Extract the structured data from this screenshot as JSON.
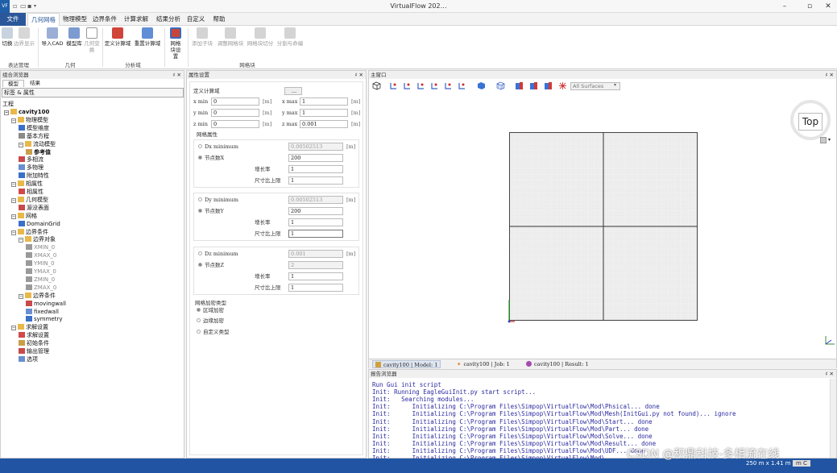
{
  "app": {
    "logo": "VF",
    "title": "VirtualFlow 202…",
    "window_controls": [
      "–",
      "▫",
      "✕"
    ]
  },
  "menu": {
    "tabs": [
      "文件",
      "几何网格",
      "物理模型",
      "边界条件",
      "计算求解",
      "结果分析",
      "自定义",
      "帮助"
    ]
  },
  "ribbon": {
    "groups": [
      {
        "label": "表达管理",
        "buttons": [
          "切换",
          "边界显示"
        ]
      },
      {
        "label": "几何",
        "buttons": [
          "导入CAD",
          "模型库",
          "几何变换"
        ]
      },
      {
        "label": "分析域",
        "buttons": [
          "定义计算域",
          "重置计算域"
        ]
      },
      {
        "label": "",
        "buttons": [
          "网格块设置"
        ]
      },
      {
        "label": "网格块",
        "buttons": [
          "添加子块",
          "调整网格块",
          "网格块切分",
          "分割与命编"
        ]
      }
    ]
  },
  "left_panel": {
    "title": "组合浏览器",
    "tabs": [
      "模型",
      "结果"
    ],
    "tag_header": "标签 & 属性",
    "tree_root": "工程",
    "tree": [
      {
        "label": "cavity100",
        "level": 0,
        "bold": true
      },
      {
        "label": "物理模型",
        "level": 1
      },
      {
        "label": "模型维度",
        "level": 2
      },
      {
        "label": "基本方程",
        "level": 2
      },
      {
        "label": "流动模型",
        "level": 2
      },
      {
        "label": "参考值",
        "level": 3,
        "bold": true
      },
      {
        "label": "多相流",
        "level": 2
      },
      {
        "label": "多物理",
        "level": 2
      },
      {
        "label": "附加特性",
        "level": 2
      },
      {
        "label": "相属性",
        "level": 1
      },
      {
        "label": "相属性",
        "level": 2
      },
      {
        "label": "几何模型",
        "level": 1
      },
      {
        "label": "源没表面",
        "level": 2
      },
      {
        "label": "网格",
        "level": 1
      },
      {
        "label": "DomainGrid",
        "level": 2
      },
      {
        "label": "边界条件",
        "level": 1
      },
      {
        "label": "边界对象",
        "level": 2
      },
      {
        "label": "XMIN_0",
        "level": 3,
        "gray": true
      },
      {
        "label": "XMAX_0",
        "level": 3,
        "gray": true
      },
      {
        "label": "YMIN_0",
        "level": 3,
        "gray": true
      },
      {
        "label": "YMAX_0",
        "level": 3,
        "gray": true
      },
      {
        "label": "ZMIN_0",
        "level": 3,
        "gray": true
      },
      {
        "label": "ZMAX_0",
        "level": 3,
        "gray": true
      },
      {
        "label": "边界条件",
        "level": 2
      },
      {
        "label": "movingwall",
        "level": 3
      },
      {
        "label": "fixedwall",
        "level": 3
      },
      {
        "label": "symmetry",
        "level": 3
      },
      {
        "label": "求解设置",
        "level": 1
      },
      {
        "label": "求解设置",
        "level": 2
      },
      {
        "label": "初始条件",
        "level": 2
      },
      {
        "label": "输出管理",
        "level": 2
      },
      {
        "label": "选项",
        "level": 2
      }
    ]
  },
  "props": {
    "title": "属性设置",
    "domain_label": "定义计算域",
    "dots_button": "...",
    "xmin_label": "x min",
    "xmin": "0",
    "xmax_label": "x max",
    "xmax": "1",
    "ymin_label": "y min",
    "ymin": "0",
    "ymax_label": "y max",
    "ymax": "1",
    "zmin_label": "z min",
    "zmin": "0",
    "zmax_label": "z max",
    "zmax": "0.001",
    "unit": "[m]",
    "mesh_props_label": "网格属性",
    "x": {
      "min_label": "Dx minimum",
      "min": "0.00502513",
      "count_label": "节点数X",
      "count": "200",
      "growth_label": "增长率",
      "growth": "1",
      "ratio_label": "尺寸比上限",
      "ratio": "1"
    },
    "y": {
      "min_label": "Dy minimum",
      "min": "0.00502513",
      "count_label": "节点数Y",
      "count": "200",
      "growth_label": "增长率",
      "growth": "1",
      "ratio_label": "尺寸比上限",
      "ratio": "1"
    },
    "z": {
      "min_label": "Dz minimum",
      "min": "0.001",
      "count_label": "节点数Z",
      "count": "2",
      "growth_label": "增长率",
      "growth": "1",
      "ratio_label": "尺寸比上限",
      "ratio": "1"
    },
    "refine_label": "网格加密类型",
    "refine_options": [
      "区域加密",
      "边缘加密",
      "自定义类型"
    ],
    "refine_selected": 0
  },
  "viewport": {
    "title": "主窗口",
    "surface_select": "All Surfaces",
    "cube_label": "Top",
    "tabs": [
      {
        "label": "cavity100",
        "info": "Model: 1"
      },
      {
        "label": "cavity100",
        "info": "Job: 1"
      },
      {
        "label": "cavity100",
        "info": "Result: 1"
      }
    ]
  },
  "report": {
    "title": "报告浏览器",
    "lines": [
      "Run Gui init script",
      "Init: Running EagleGuiInit.py start script...",
      "Init:   Searching modules...",
      "Init:      Initializing C:\\Program Files\\Simpop\\VirtualFlow\\Mod\\Phsical... done",
      "Init:      Initializing C:\\Program Files\\Simpop\\VirtualFlow\\Mod\\Mesh(InitGui.py not found)... ignore",
      "Init:      Initializing C:\\Program Files\\Simpop\\VirtualFlow\\Mod\\Start... done",
      "Init:      Initializing C:\\Program Files\\Simpop\\VirtualFlow\\Mod\\Part... done",
      "Init:      Initializing C:\\Program Files\\Simpop\\VirtualFlow\\Mod\\Solve... done",
      "Init:      Initializing C:\\Program Files\\Simpop\\VirtualFlow\\Mod\\Result... done",
      "Init:      Initializing C:\\Program Files\\Simpop\\VirtualFlow\\Mod\\UDF... done",
      "Init:      Initializing C:\\Program Files\\Simpop\\VirtualFlow\\Mod\\..."
    ]
  },
  "status": {
    "dims": "250 m x 1.41 m",
    "unit": "m C",
    "watermark": "CSDN @积鼎科技-多相流在线"
  },
  "colors": {
    "accent": "#2b579a",
    "statusbar": "#2155a3",
    "report_text": "#2a2aa0"
  }
}
